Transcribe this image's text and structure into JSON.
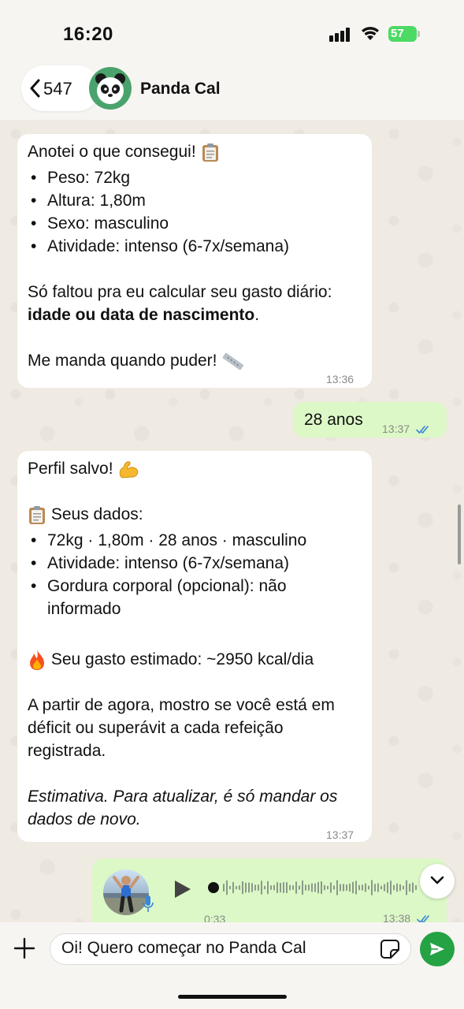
{
  "status_bar": {
    "time": "16:20",
    "battery": "57"
  },
  "header": {
    "back_count": "547",
    "contact_name": "Panda Cal"
  },
  "messages": [
    {
      "direction": "incoming",
      "intro": "Anotei o que consegui!",
      "bullets": [
        "Peso: 72kg",
        "Altura: 1,80m",
        "Sexo: masculino",
        "Atividade: intenso (6-7x/semana)"
      ],
      "missing_text": "Só faltou pra eu calcular seu gasto diário:",
      "missing_bold": "idade ou data de nascimento",
      "missing_end": ".",
      "closing": "Me manda quando puder!",
      "time": "13:36"
    },
    {
      "direction": "outgoing",
      "text": "28 anos",
      "time": "13:37"
    },
    {
      "direction": "incoming",
      "title": "Perfil salvo!",
      "data_heading": "Seus dados:",
      "bullets": [
        "72kg · 1,80m · 28 anos · masculino",
        "Atividade: intenso (6-7x/semana)",
        "Gordura corporal (opcional): não informado"
      ],
      "estimate": "Seu gasto estimado: ~2950 kcal/dia",
      "paragraph": "A partir de agora, mostro se você está em déficit ou superávit a cada refeição registrada.",
      "italic_note": "Estimativa. Para atualizar, é só mandar os dados de novo.",
      "time": "13:37"
    },
    {
      "direction": "outgoing",
      "type": "audio",
      "duration": "0:33",
      "time": "13:38"
    }
  ],
  "composer": {
    "value": "Oi! Quero começar no Panda Cal"
  },
  "colors": {
    "outgoing_bubble": "#dcf8c6",
    "incoming_bubble": "#ffffff",
    "accent_green": "#25a244",
    "read_ticks": "#3a86d8"
  },
  "icons": [
    "back-chevron-icon",
    "panda-avatar-icon",
    "clipboard-icon",
    "ruler-icon",
    "flexed-biceps-icon",
    "fire-icon",
    "double-check-icon",
    "play-icon",
    "microphone-icon",
    "chevron-down-icon",
    "plus-icon",
    "sticker-icon",
    "send-icon"
  ]
}
